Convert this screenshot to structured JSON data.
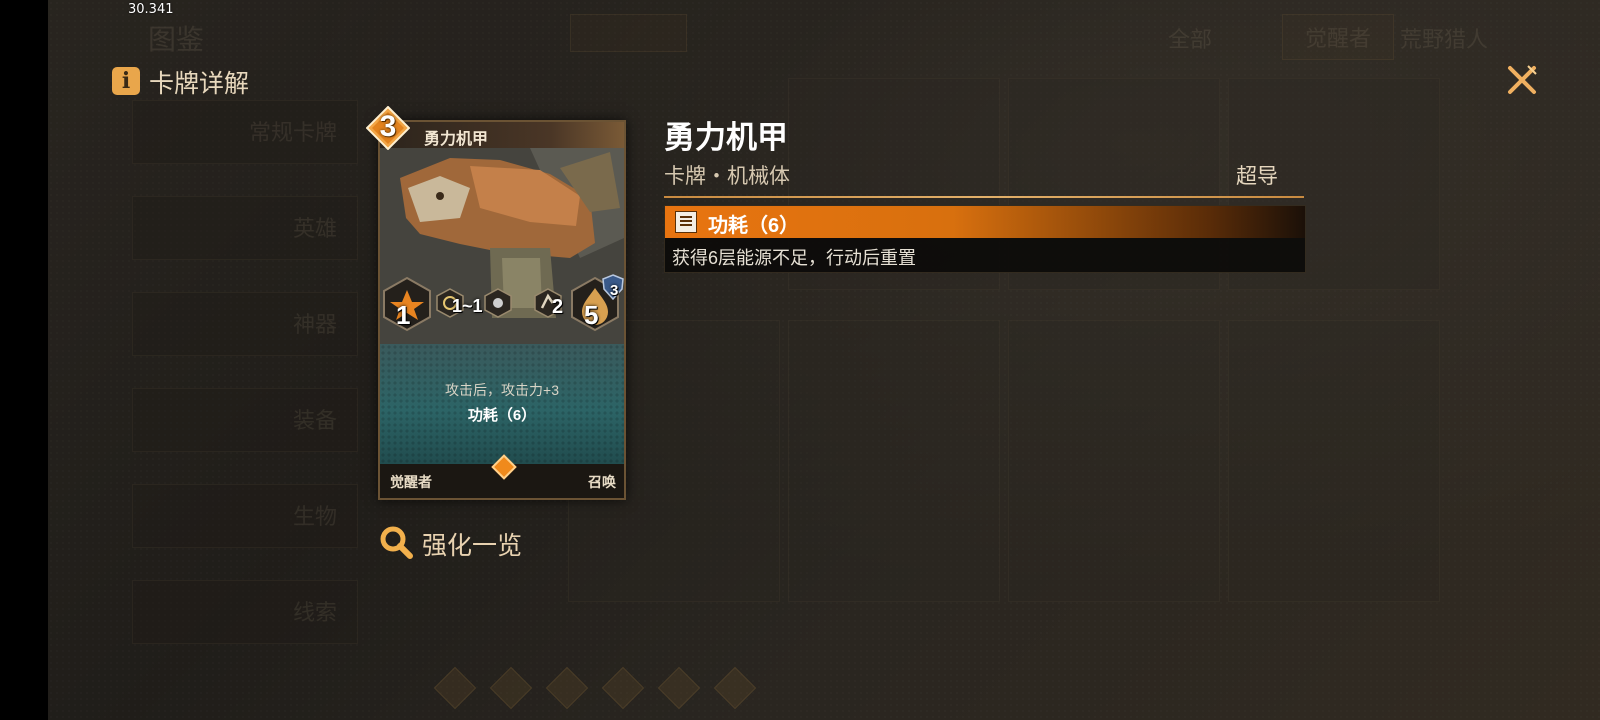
{
  "status": {
    "fps": "30.341"
  },
  "background": {
    "header_title": "图鉴",
    "filter_tabs": [
      "全部",
      "觉醒者",
      "荒野猎人"
    ],
    "sidebar": [
      "常规卡牌",
      "英雄",
      "神器",
      "装备",
      "生物",
      "线索"
    ]
  },
  "panel": {
    "title": "卡牌详解",
    "title_icon": "info-icon",
    "close_icon": "close-icon"
  },
  "card": {
    "cost": "3",
    "name": "勇力机甲",
    "attack": "1",
    "range": "1~1",
    "move": "2",
    "health": "5",
    "shield": "3",
    "effect_line1": "攻击后，攻击力+3",
    "effect_line2": "功耗（6）",
    "class_label": "觉醒者",
    "type_label": "召唤"
  },
  "upgrade": {
    "label": "强化一览",
    "icon": "magnifier-icon"
  },
  "info": {
    "name": "勇力机甲",
    "subtitle": "卡牌・机械体",
    "rarity": "超导",
    "keyword": {
      "title": "功耗（6）",
      "description": "获得6层能源不足，行动后重置"
    }
  },
  "colors": {
    "accent": "#e87410",
    "gold": "#e9a64b",
    "card_teal": "#2c6466"
  }
}
